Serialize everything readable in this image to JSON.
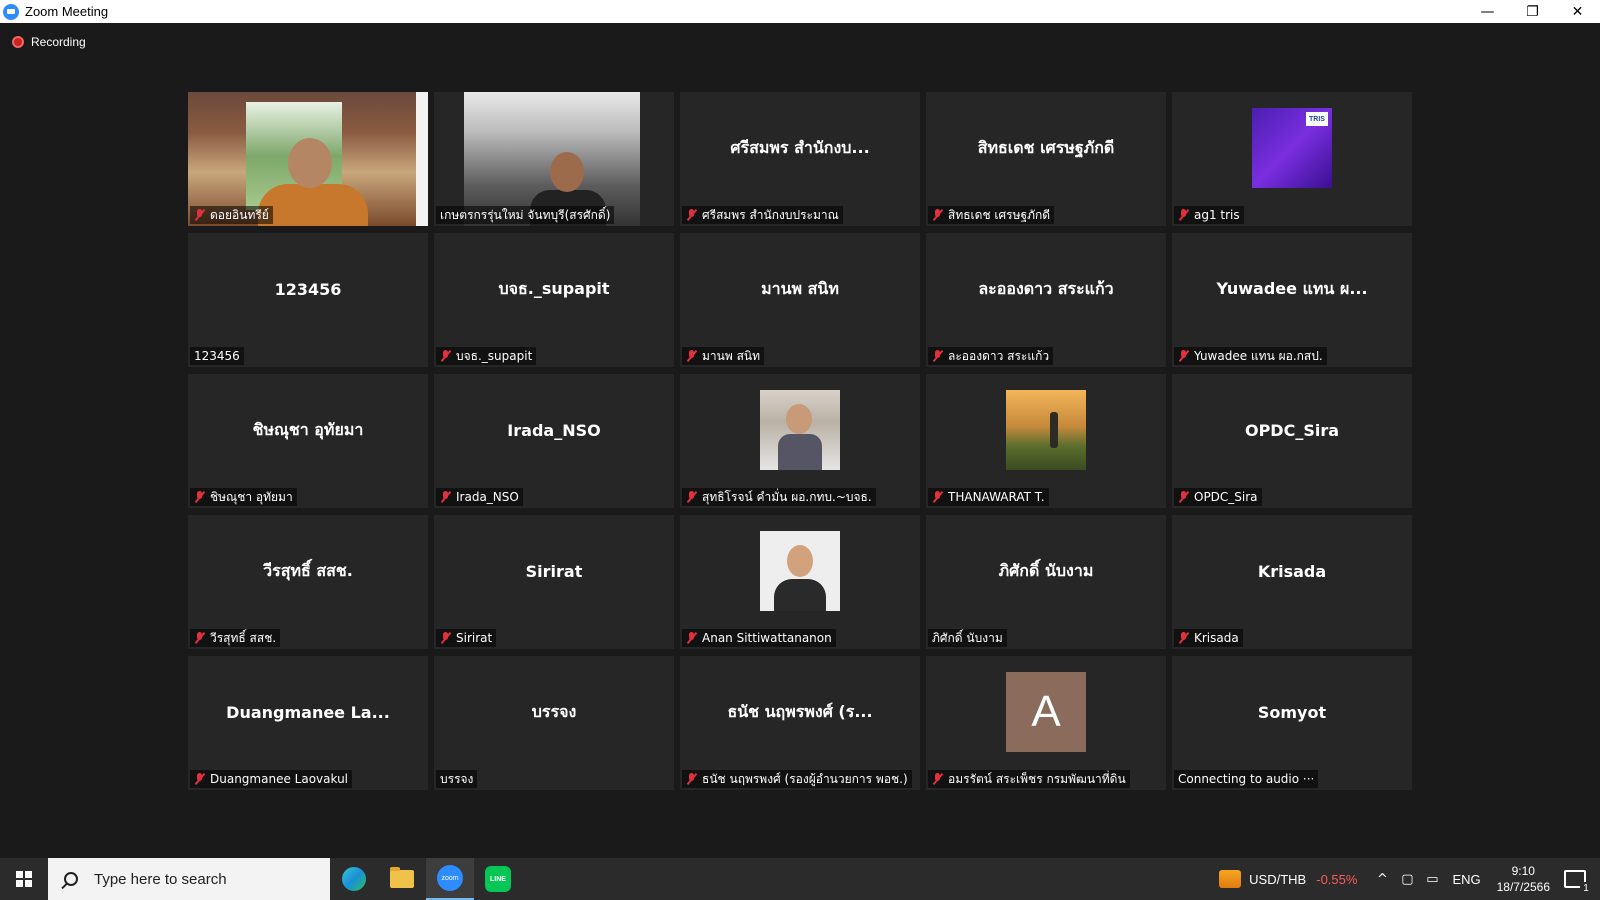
{
  "window": {
    "title": "Zoom Meeting",
    "minimize": "—",
    "restore": "❐",
    "close": "✕"
  },
  "recording": {
    "label": "Recording"
  },
  "tiles": [
    {
      "label": "ดอยอินทรีย์",
      "muted": true
    },
    {
      "label": "เกษตรกรรุ่นใหม่ จันทบุรี(สรศักดิ์)",
      "muted": false
    },
    {
      "center": "ศรีสมพร สำนักงบ...",
      "label": "ศรีสมพร สำนักงบประมาณ",
      "muted": true
    },
    {
      "center": "สิทธเดช เศรษฐภักดี",
      "label": "สิทธเดช เศรษฐภักดี",
      "muted": true
    },
    {
      "avatar_text": "TRIS",
      "label": "ag1 tris",
      "muted": true
    },
    {
      "center": "123456",
      "label": "123456",
      "muted": false
    },
    {
      "center": "บจธ._supapit",
      "label": "บจธ._supapit",
      "muted": true
    },
    {
      "center": "มานพ สนิท",
      "label": "มานพ สนิท",
      "muted": true
    },
    {
      "center": "ละอองดาว สระแก้ว",
      "label": "ละอองดาว สระแก้ว",
      "muted": true
    },
    {
      "center": "Yuwadee แทน ผ...",
      "label": "Yuwadee แทน ผอ.กสป.",
      "muted": true
    },
    {
      "center": "ชิษณุชา อุทัยมา",
      "label": "ชิษณุชา อุทัยมา",
      "muted": true
    },
    {
      "center": "Irada_NSO",
      "label": "Irada_NSO",
      "muted": true
    },
    {
      "label": "สุทธิโรจน์ คำมั่น ผอ.กทบ.~บจธ.",
      "muted": true
    },
    {
      "label": "THANAWARAT T.",
      "muted": true
    },
    {
      "center": "OPDC_Sira",
      "label": "OPDC_Sira",
      "muted": true
    },
    {
      "center": "วีรสุทธิ์ สสช.",
      "label": "วีรสุทธิ์ สสช.",
      "muted": true
    },
    {
      "center": "Sirirat",
      "label": "Sirirat",
      "muted": true
    },
    {
      "label": "Anan Sittiwattananon",
      "muted": true
    },
    {
      "center": "ภิศักดิ์ นับงาม",
      "label": "ภิศักดิ์ นับงาม",
      "muted": false
    },
    {
      "center": "Krisada",
      "label": "Krisada",
      "muted": true
    },
    {
      "center": "Duangmanee La...",
      "label": "Duangmanee Laovakul",
      "muted": true
    },
    {
      "center": "บรรจง",
      "label": "บรรจง",
      "muted": false
    },
    {
      "center": "ธนัช นฤพรพงศ์ (ร...",
      "label": "ธนัช นฤพรพงศ์ (รองผู้อำนวยการ พอช.)",
      "muted": true
    },
    {
      "avatar_letter": "A",
      "label": "อมรรัตน์ สระเพ็ชร กรมพัฒนาที่ดิน",
      "muted": true
    },
    {
      "center": "Somyot",
      "label": "Connecting to audio ···",
      "muted": false
    }
  ],
  "taskbar": {
    "search_placeholder": "Type here to search",
    "zoom_text": "zoom",
    "line_text": "LINE",
    "currency_pair": "USD/THB",
    "currency_change": "-0.55%",
    "caret": "^",
    "language": "ENG",
    "time": "9:10",
    "date": "18/7/2566",
    "notification_count": "1"
  },
  "colors": {
    "muted_red": "#e0313c",
    "tile_bg": "#262626",
    "app_bg": "#1a1a1a",
    "zoom_blue": "#2d8cff"
  }
}
